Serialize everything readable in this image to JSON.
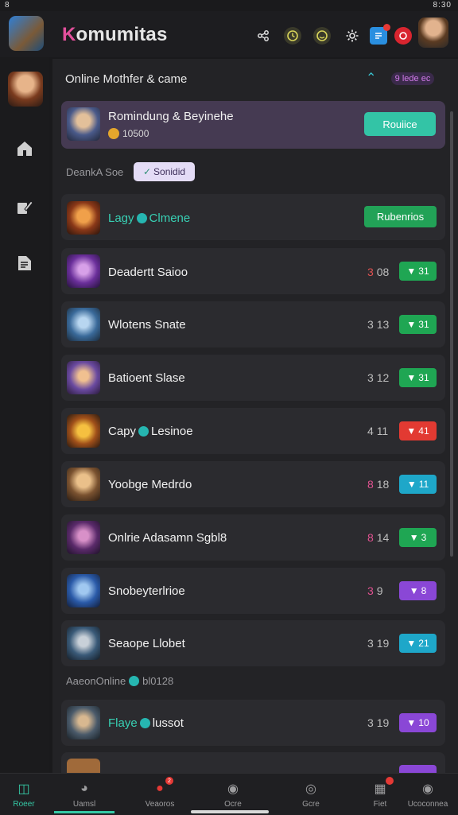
{
  "status_bar": {
    "left": "8",
    "right": "8:30"
  },
  "header": {
    "title_first": "K",
    "title_rest": "omumitas",
    "icons": [
      "share-icon",
      "clock-icon",
      "emoji-icon",
      "settings-icon",
      "chat-icon",
      "notification-icon"
    ],
    "notification_count": "1"
  },
  "sidebar": {
    "items": [
      "home-icon",
      "edit-icon",
      "document-icon"
    ]
  },
  "panel": {
    "title": "Online Mothfer & came",
    "badge": "9 lede ec",
    "featured": {
      "title": "Romindung & Beyinehe",
      "sub": "10500",
      "button": "Rouiice"
    },
    "section_label": "DeankA Soe",
    "filter_chip": "Sonidid",
    "rows": [
      {
        "name": "Lagy",
        "name2": "Clmene",
        "highlight": true,
        "button": "Rubenrios"
      },
      {
        "name": "Deadertt Saioo",
        "stat_a": "3",
        "stat_b": "08",
        "pill": "31",
        "color": "#1fa653"
      },
      {
        "name": "Wlotens Snate",
        "stat_a": "3",
        "stat_b": "13",
        "pill": "31",
        "color": "#1fa653"
      },
      {
        "name": "Batioent Slase",
        "stat_a": "3",
        "stat_b": "12",
        "pill": "31",
        "color": "#1fa653"
      },
      {
        "name": "Capy",
        "name2": "Lesinoe",
        "stat_a": "4",
        "stat_b": "11",
        "pill": "41",
        "color": "#e23a32"
      },
      {
        "name": "Yoobge Medrdo",
        "stat_a": "8",
        "stat_b": "18",
        "pill": "11",
        "color": "#1ea7c9"
      },
      {
        "name": "Onlrie Adasamn Sgbl8",
        "stat_a": "8",
        "stat_b": "14",
        "pill": "3",
        "color": "#1fa653"
      },
      {
        "name": "Snobeyterlrioe",
        "stat_a": "3",
        "stat_b": "9",
        "pill": "8",
        "color": "#8a47d6"
      },
      {
        "name": "Seaope Llobet",
        "stat_a": "3",
        "stat_b": "19",
        "pill": "21",
        "color": "#1ea7c9"
      }
    ],
    "section2_label": "AaeonOnline",
    "section2_code": "bl0128",
    "rows2": [
      {
        "name": "Flaye",
        "name2": "lussot",
        "highlight": true,
        "stat_a": "3",
        "stat_b": "19",
        "pill": "10",
        "color": "#8a47d6"
      }
    ]
  },
  "bottom_nav": [
    {
      "label": "Roeer",
      "icon": "games-icon",
      "active": true
    },
    {
      "label": "Uamsl",
      "icon": "compass-icon"
    },
    {
      "label": "Veaoros",
      "icon": "friends-icon",
      "badge": "2"
    },
    {
      "label": "Ocre",
      "icon": "trophy-icon"
    },
    {
      "label": "Gcre",
      "icon": "store-icon"
    },
    {
      "label": "Fiet",
      "icon": "inbox-icon",
      "badge": ""
    },
    {
      "label": "Ucoconnea",
      "icon": "profile-icon"
    }
  ]
}
